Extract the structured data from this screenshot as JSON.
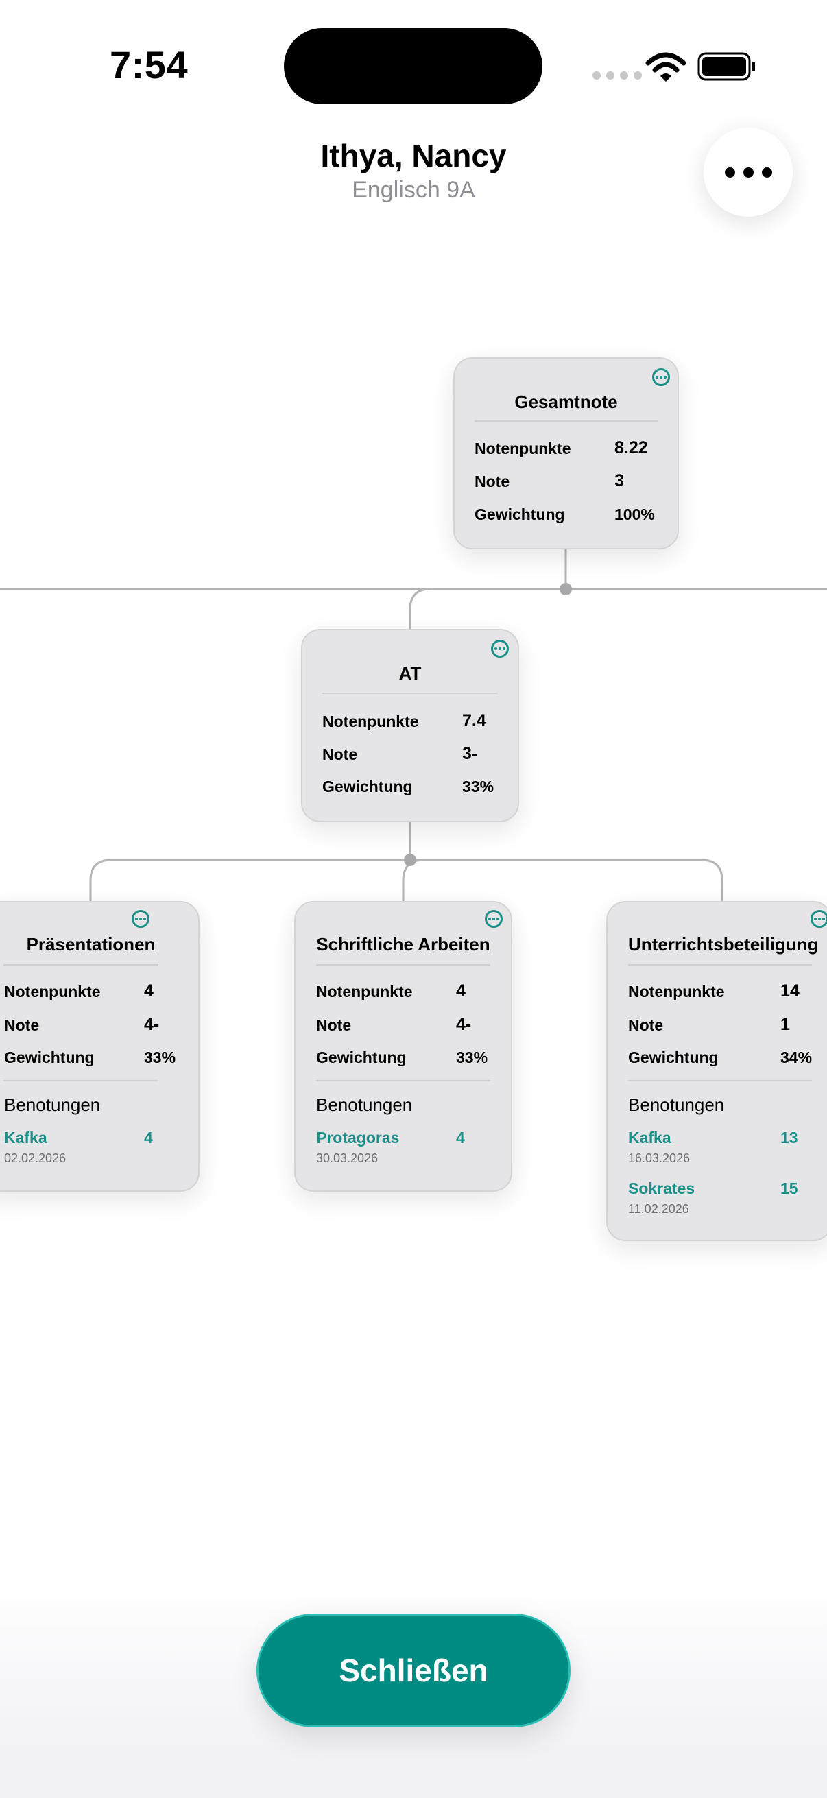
{
  "status": {
    "time": "7:54"
  },
  "header": {
    "student_name": "Ithya, Nancy",
    "course": "Englisch 9A"
  },
  "labels": {
    "points": "Notenpunkte",
    "grade": "Note",
    "weight": "Gewichtung",
    "gradings": "Benotungen"
  },
  "cards": {
    "total": {
      "title": "Gesamtnote",
      "points": "8.22",
      "grade": "3",
      "weight": "100%"
    },
    "at": {
      "title": "AT",
      "points": "7.4",
      "grade": "3-",
      "weight": "33%"
    },
    "presentations": {
      "title": "Präsentationen",
      "points": "4",
      "grade": "4-",
      "weight": "33%",
      "gradings": [
        {
          "name": "Kafka",
          "value": "4",
          "date": "02.02.2026"
        }
      ]
    },
    "written": {
      "title": "Schriftliche Arbeiten",
      "points": "4",
      "grade": "4-",
      "weight": "33%",
      "gradings": [
        {
          "name": "Protagoras",
          "value": "4",
          "date": "30.03.2026"
        }
      ]
    },
    "participation": {
      "title": "Unterrichtsbeteiligung",
      "points": "14",
      "grade": "1",
      "weight": "34%",
      "gradings": [
        {
          "name": "Kafka",
          "value": "13",
          "date": "16.03.2026"
        },
        {
          "name": "Sokrates",
          "value": "15",
          "date": "11.02.2026"
        }
      ]
    }
  },
  "footer": {
    "close_label": "Schließen"
  },
  "colors": {
    "accent": "#008c82",
    "teal_text": "#1a9088",
    "card_bg": "#e5e5e7",
    "connector": "#b4b4b6"
  }
}
